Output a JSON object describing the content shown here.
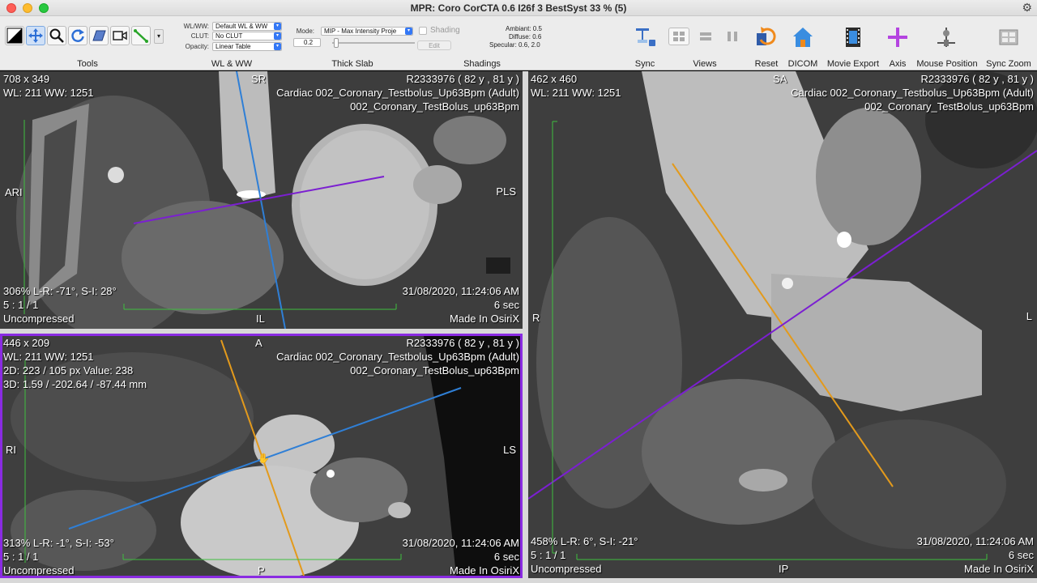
{
  "window": {
    "title": "MPR: Coro CorCTA 0.6 I26f 3 BestSyst 33 % (5)"
  },
  "toolbar": {
    "groups": {
      "tools": "Tools",
      "wlww": "WL & WW",
      "thick_slab": "Thick Slab",
      "shadings": "Shadings",
      "sync": "Sync",
      "views": "Views",
      "reset": "Reset",
      "dicom": "DICOM",
      "movie_export": "Movie Export",
      "axis": "Axis",
      "mouse_position": "Mouse Position",
      "sync_zoom": "Sync Zoom"
    },
    "wl": {
      "wlww_label": "WL/WW:",
      "wlww_value": "Default WL & WW",
      "clut_label": "CLUT:",
      "clut_value": "No CLUT",
      "opacity_label": "Opacity:",
      "opacity_value": "Linear Table"
    },
    "slab": {
      "mode_label": "Mode:",
      "mode_value": "MIP - Max Intensity Proje",
      "thickness_value": "0.2",
      "shading_label": "Shading",
      "edit_label": "Edit"
    },
    "shading_params": {
      "ambient": "Ambiant: 0.5",
      "diffuse": "Diffuse: 0.6",
      "specular": "Specular: 0.6, 2.0"
    }
  },
  "viewports": {
    "top_left": {
      "size": "708 x 349",
      "wlww": "WL: 211 WW: 1251",
      "patient": "R2333976 ( 82 y , 81 y )",
      "study": "Cardiac 002_Coronary_Testbolus_Up63Bpm (Adult)",
      "series": "002_Coronary_TestBolus_up63Bpm",
      "zoom": "306% L-R: -71°, S-I: 28°",
      "ratio": "5 : 1 / 1",
      "compression": "Uncompressed",
      "date": "31/08/2020, 11:24:06 AM",
      "duration": "6 sec",
      "made_in": "Made In OsiriX",
      "orient_top": "SR",
      "orient_bottom": "IL",
      "orient_left": "ARI",
      "orient_right": "PLS"
    },
    "bottom_left": {
      "size": "446 x 209",
      "wlww": "WL: 211 WW: 1251",
      "pixel": "2D: 223 / 105 px Value: 238",
      "coords": "3D: 1.59 / -202.64 / -87.44 mm",
      "patient": "R2333976 ( 82 y , 81 y )",
      "study": "Cardiac 002_Coronary_Testbolus_Up63Bpm (Adult)",
      "series": "002_Coronary_TestBolus_up63Bpm",
      "zoom": "313% L-R: -1°, S-I: -53°",
      "ratio": "5 : 1 / 1",
      "compression": "Uncompressed",
      "date": "31/08/2020, 11:24:06 AM",
      "duration": "6 sec",
      "made_in": "Made In OsiriX",
      "orient_top": "A",
      "orient_bottom": "P",
      "orient_left": "RI",
      "orient_right": "LS"
    },
    "right": {
      "size": "462 x 460",
      "wlww": "WL: 211 WW: 1251",
      "patient": "R2333976 ( 82 y , 81 y )",
      "study": "Cardiac 002_Coronary_Testbolus_Up63Bpm (Adult)",
      "series": "002_Coronary_TestBolus_up63Bpm",
      "zoom": "458% L-R: 6°, S-I: -21°",
      "ratio": "5 : 1 / 1",
      "compression": "Uncompressed",
      "date": "31/08/2020, 11:24:06 AM",
      "duration": "6 sec",
      "made_in": "Made In OsiriX",
      "orient_top": "SA",
      "orient_bottom": "IP",
      "orient_left": "R",
      "orient_right": "L"
    }
  },
  "colors": {
    "axis_blue": "#2f7fd6",
    "axis_purple": "#7b1fd1",
    "axis_orange": "#e39a1c",
    "scale_green": "#3fbf3f",
    "active_border": "#8a2be2"
  }
}
